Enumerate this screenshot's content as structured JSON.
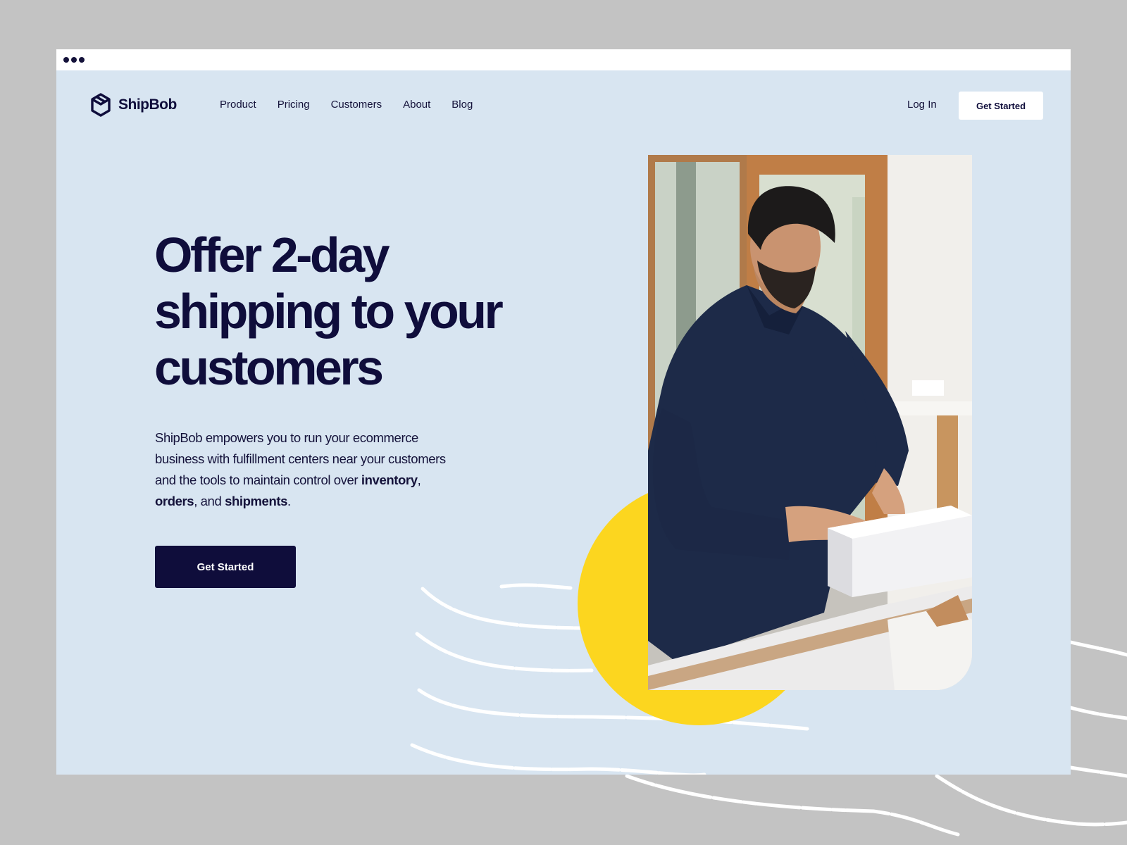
{
  "brand": {
    "name": "ShipBob",
    "logo_icon": "hexagon-box-icon"
  },
  "nav": {
    "items": [
      {
        "label": "Product"
      },
      {
        "label": "Pricing"
      },
      {
        "label": "Customers"
      },
      {
        "label": "About"
      },
      {
        "label": "Blog"
      }
    ],
    "login_label": "Log In",
    "cta_label": "Get Started"
  },
  "hero": {
    "headline_lines": [
      "Offer 2-day",
      "shipping to your",
      "customers"
    ],
    "body": {
      "intro": "ShipBob empowers you to run your ecommerce business with fulfillment centers near your customers and the tools to maintain control over ",
      "bold_1": "inventory",
      "sep_1": ", ",
      "bold_2": "orders",
      "sep_2": ", and ",
      "bold_3": "shipments",
      "end": "."
    },
    "cta_label": "Get Started"
  },
  "colors": {
    "page_bg": "#c3c3c3",
    "hero_bg": "#d8e5f1",
    "navy": "#0f0d3b",
    "accent_yellow": "#fcd61f",
    "white": "#ffffff"
  }
}
